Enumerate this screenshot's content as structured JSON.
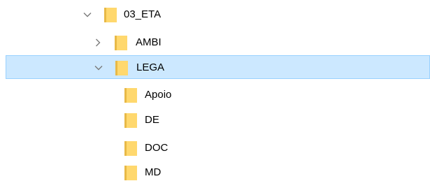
{
  "tree": {
    "items": [
      {
        "label": "03_ETA",
        "expander": "chevron-down-icon",
        "icon": "folder-icon",
        "selected": false
      },
      {
        "label": "AMBI",
        "expander": "chevron-right-icon",
        "icon": "folder-icon",
        "selected": false
      },
      {
        "label": "LEGA",
        "expander": "chevron-down-icon",
        "icon": "folder-icon",
        "selected": true
      },
      {
        "label": "Apoio",
        "expander": null,
        "icon": "folder-icon",
        "selected": false
      },
      {
        "label": "DE",
        "expander": null,
        "icon": "folder-icon",
        "selected": false
      },
      {
        "label": "DOC",
        "expander": null,
        "icon": "folder-icon",
        "selected": false
      },
      {
        "label": "MD",
        "expander": null,
        "icon": "folder-icon",
        "selected": false
      }
    ]
  },
  "colors": {
    "selection_fill": "#cce8ff",
    "selection_border": "#99d1ff",
    "folder_front": "#ffd86e",
    "folder_back": "#e8b947",
    "chevron": "#7a7a7a"
  }
}
